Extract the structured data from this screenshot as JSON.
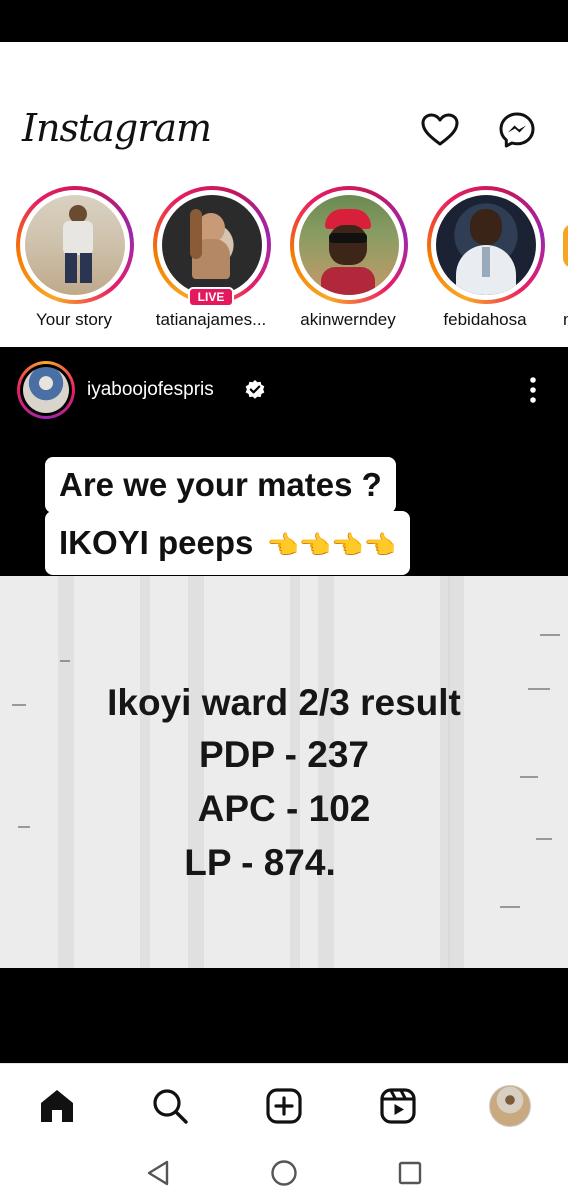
{
  "app": {
    "title": "Instagram"
  },
  "stories": [
    {
      "name": "Your story",
      "live": false
    },
    {
      "name": "tatianajames...",
      "live": true,
      "live_label": "LIVE"
    },
    {
      "name": "akinwerndey",
      "live": false
    },
    {
      "name": "febidahosa",
      "live": false
    },
    {
      "name": "n",
      "live": false
    }
  ],
  "post": {
    "username": "iyaboojofespris",
    "verified": true,
    "caption": {
      "line1": "Are we your mates ?",
      "line2": "IKOYI peeps",
      "emoji": "👈👈👈👈"
    },
    "result_lines": [
      "Ikoyi ward 2/3 result",
      "PDP - 237",
      "APC - 102",
      "LP - 874."
    ]
  },
  "icons": {
    "header": [
      "heart-icon",
      "messenger-icon"
    ],
    "bottom_nav": [
      "home-icon",
      "search-icon",
      "create-icon",
      "reels-icon",
      "profile-avatar"
    ],
    "system_nav": [
      "back-icon",
      "home-circle-icon",
      "recents-icon"
    ]
  },
  "colors": {
    "story_ring": "#e91e63",
    "live_badge": "#e4185c",
    "post_background": "#000000",
    "verified_badge": "#ffffff",
    "pointing_emoji": "#f3b21b"
  }
}
